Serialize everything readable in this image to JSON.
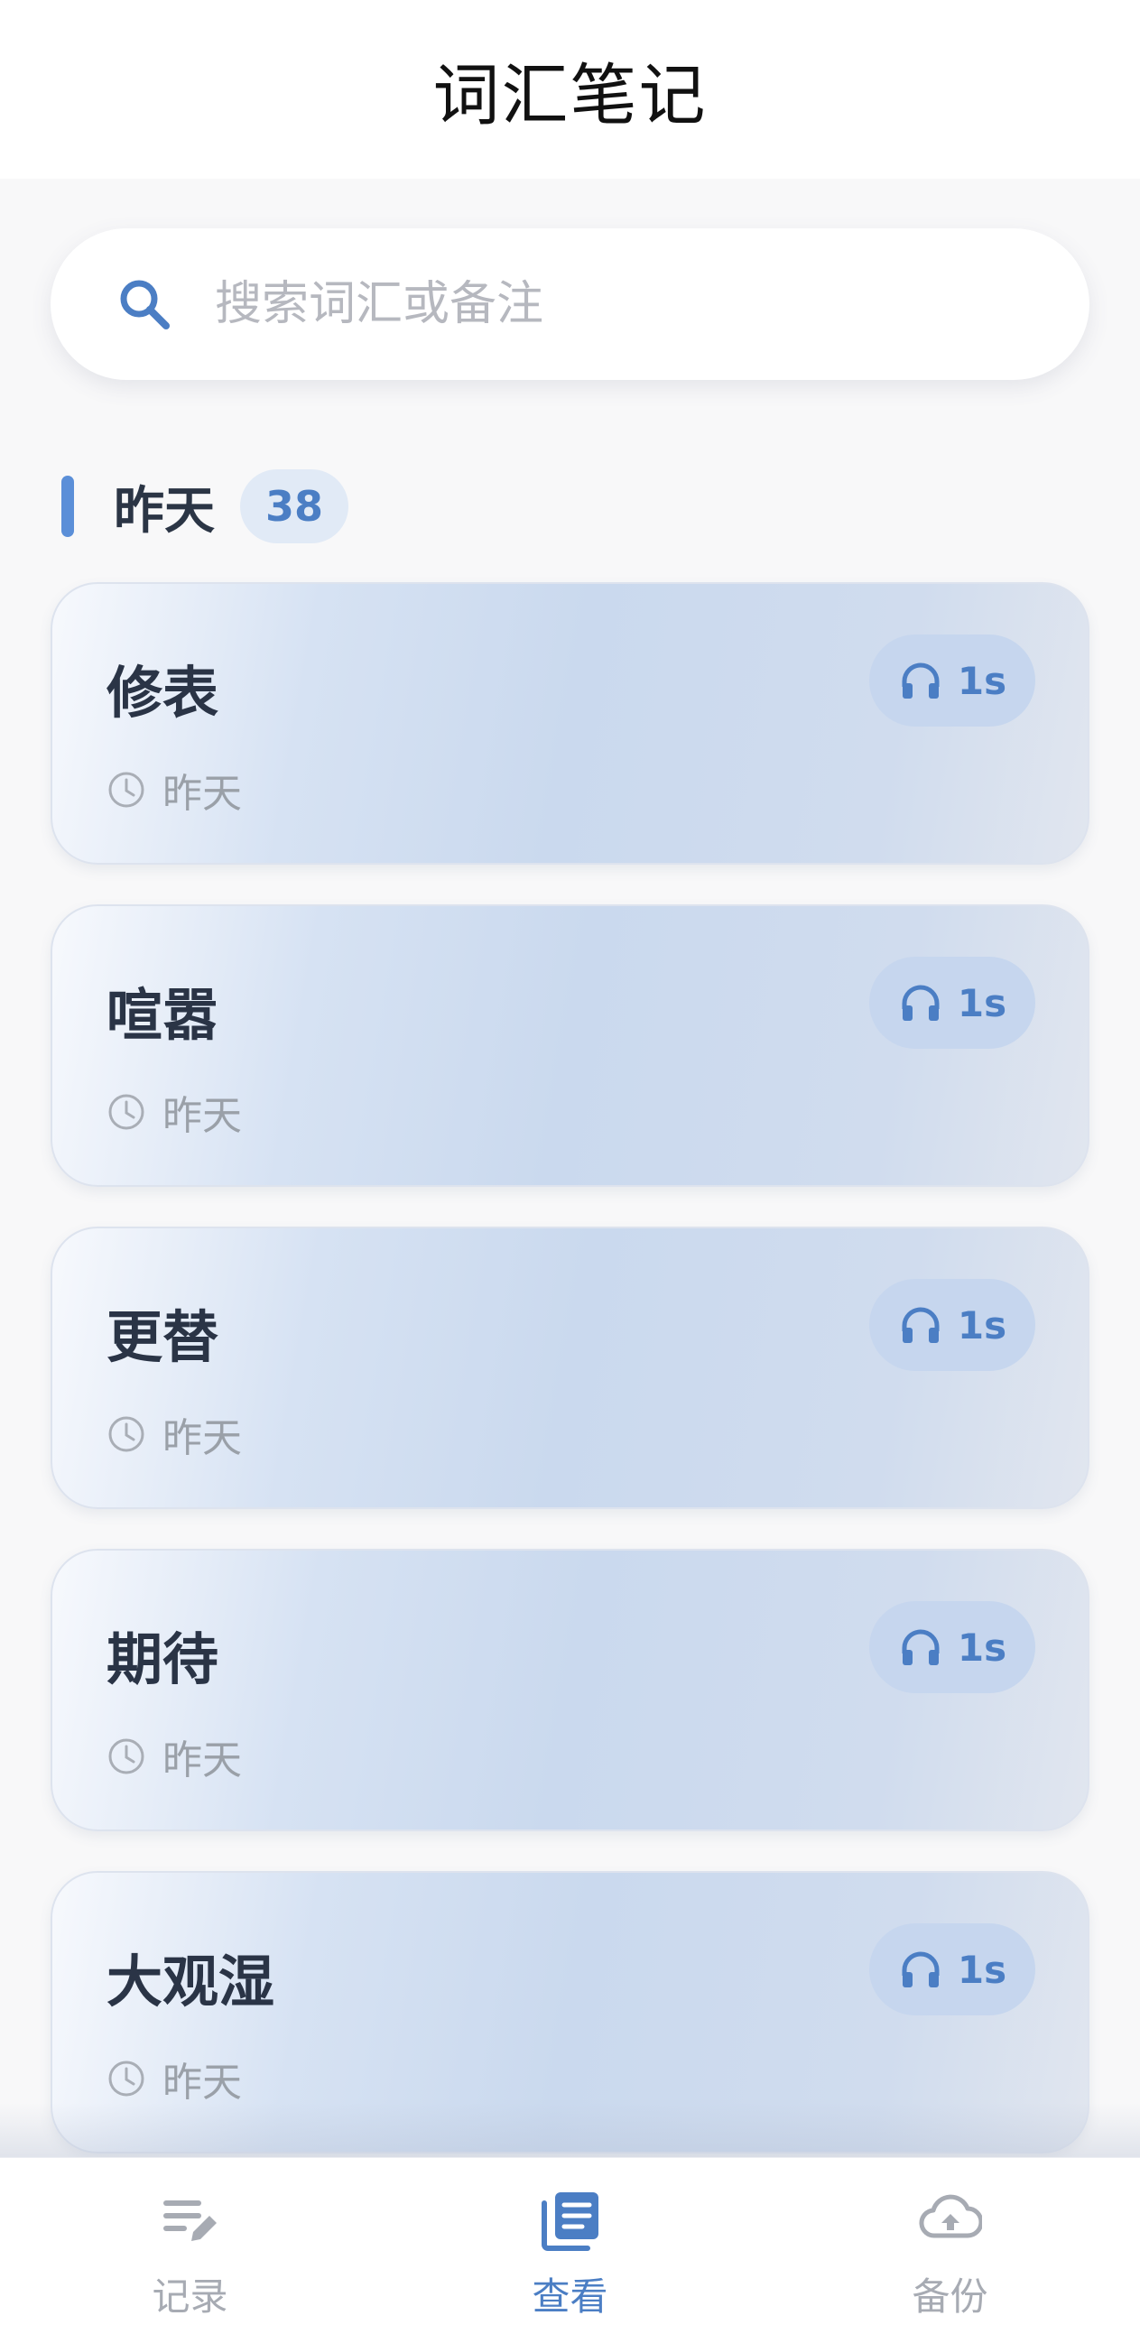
{
  "header": {
    "title": "词汇笔记"
  },
  "search": {
    "placeholder": "搜索词汇或备注",
    "icon": "search-icon"
  },
  "section": {
    "label": "昨天",
    "count": "38"
  },
  "cards": [
    {
      "word": "修表",
      "time": "昨天",
      "duration": "1s"
    },
    {
      "word": "喧嚣",
      "time": "昨天",
      "duration": "1s"
    },
    {
      "word": "更替",
      "time": "昨天",
      "duration": "1s"
    },
    {
      "word": "期待",
      "time": "昨天",
      "duration": "1s"
    },
    {
      "word": "大观湿",
      "time": "昨天",
      "duration": "1s"
    }
  ],
  "nav": {
    "record": {
      "label": "记录",
      "icon": "edit-list-icon"
    },
    "view": {
      "label": "查看",
      "icon": "notebook-icon",
      "active": true
    },
    "backup": {
      "label": "备份",
      "icon": "cloud-upload-icon"
    }
  },
  "colors": {
    "accent": "#4b7ec4",
    "accent_bar": "#5b8fd8",
    "inactive": "#a7abb3",
    "word_text": "#2a3446"
  }
}
